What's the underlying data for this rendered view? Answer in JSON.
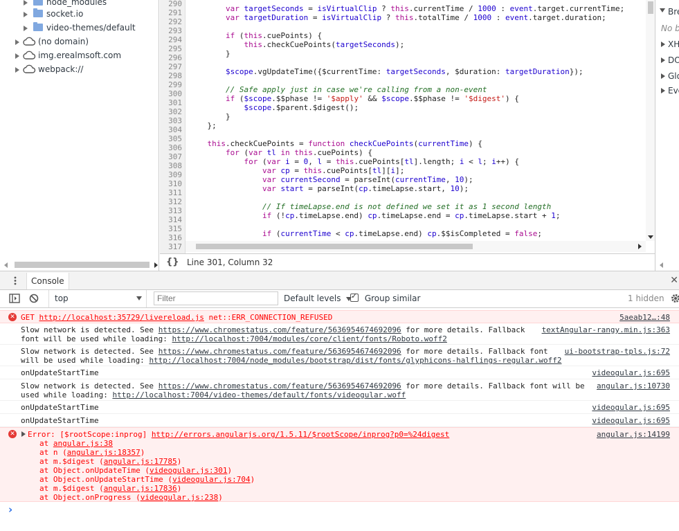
{
  "navigator": {
    "items": [
      {
        "label": "node_modules",
        "icon": "folder-icon"
      },
      {
        "label": "socket.io",
        "icon": "folder-icon"
      },
      {
        "label": "video-themes/default",
        "icon": "folder-icon"
      },
      {
        "label": "(no domain)",
        "icon": "cloud-icon"
      },
      {
        "label": "img.erealmsoft.com",
        "icon": "cloud-icon"
      },
      {
        "label": "webpack://",
        "icon": "cloud-icon"
      }
    ]
  },
  "editor": {
    "line_numbers": [
      "290",
      "291",
      "292",
      "293",
      "294",
      "295",
      "296",
      "297",
      "298",
      "299",
      "300",
      "301",
      "302",
      "303",
      "304",
      "305",
      "306",
      "307",
      "308",
      "309",
      "310",
      "311",
      "312",
      "313",
      "314",
      "315",
      "316",
      "317"
    ],
    "status": "Line 301, Column 32",
    "format_label": "{}"
  },
  "side_panel": {
    "sections": [
      "Bre",
      "No br",
      "XH",
      "DO",
      "Glo",
      "Eve"
    ]
  },
  "drawer": {
    "tab_label": "Console"
  },
  "toolbar": {
    "context": "top",
    "filter_placeholder": "Filter",
    "levels": "Default levels",
    "group_similar": "Group similar",
    "hidden_count": "1 hidden"
  },
  "console": {
    "messages": [
      {
        "type": "error",
        "text": "GET ",
        "link": "http://localhost:35729/livereload.js",
        "tail": " net::ERR_CONNECTION_REFUSED",
        "source": "5aeab12…:48"
      },
      {
        "type": "log",
        "line1a": "Slow network is detected. See ",
        "line1link": "https://www.chromestatus.com/feature/5636954674692096",
        "line1b": " for more details. Fallback",
        "line2a": "font will be used while loading: ",
        "line2link": "http://localhost:7004/modules/core/client/fonts/Roboto.woff2",
        "source": "textAngular-rangy.min.js:363"
      },
      {
        "type": "log",
        "line1a": "Slow network is detected. See ",
        "line1link": "https://www.chromestatus.com/feature/5636954674692096",
        "line1b": " for more details. Fallback font",
        "line2a": "will be used while loading: ",
        "line2link": "http://localhost:7004/node_modules/bootstrap/dist/fonts/glyphicons-halflings-regular.woff2",
        "source": "ui-bootstrap-tpls.js:72"
      },
      {
        "type": "log",
        "text": "onUpdateStartTime",
        "source": "videogular.js:695"
      },
      {
        "type": "log",
        "line1a": "Slow network is detected. See ",
        "line1link": "https://www.chromestatus.com/feature/5636954674692096",
        "line1b": " for more details. Fallback font will be",
        "line2a": "used while loading: ",
        "line2link": "http://localhost:7004/video-themes/default/fonts/videogular.woff",
        "source": "angular.js:10730"
      },
      {
        "type": "log",
        "text": "onUpdateStartTime",
        "source": "videogular.js:695"
      },
      {
        "type": "log",
        "text": "onUpdateStartTime",
        "source": "videogular.js:695"
      },
      {
        "type": "error",
        "text": "Error: [$rootScope:inprog] ",
        "link": "http://errors.angularjs.org/1.5.11/$rootScope/inprog?p0=%24digest",
        "source": "angular.js:14199",
        "stack": [
          {
            "pre": "at ",
            "link": "angular.js:38",
            "post": ""
          },
          {
            "pre": "at n (",
            "link": "angular.js:18357",
            "post": ")"
          },
          {
            "pre": "at m.$digest (",
            "link": "angular.js:17785",
            "post": ")"
          },
          {
            "pre": "at Object.onUpdateTime (",
            "link": "videogular.js:301",
            "post": ")"
          },
          {
            "pre": "at Object.onUpdateStartTime (",
            "link": "videogular.js:704",
            "post": ")"
          },
          {
            "pre": "at m.$digest (",
            "link": "angular.js:17836",
            "post": ")"
          },
          {
            "pre": "at Object.onProgress (",
            "link": "videogular.js:238",
            "post": ")"
          }
        ]
      }
    ],
    "prompt": "›"
  },
  "colors": {
    "error_bg": "#fff0f0",
    "error_text": "#ff0000",
    "keyword": "#aa0d91",
    "comment": "#236e25"
  }
}
